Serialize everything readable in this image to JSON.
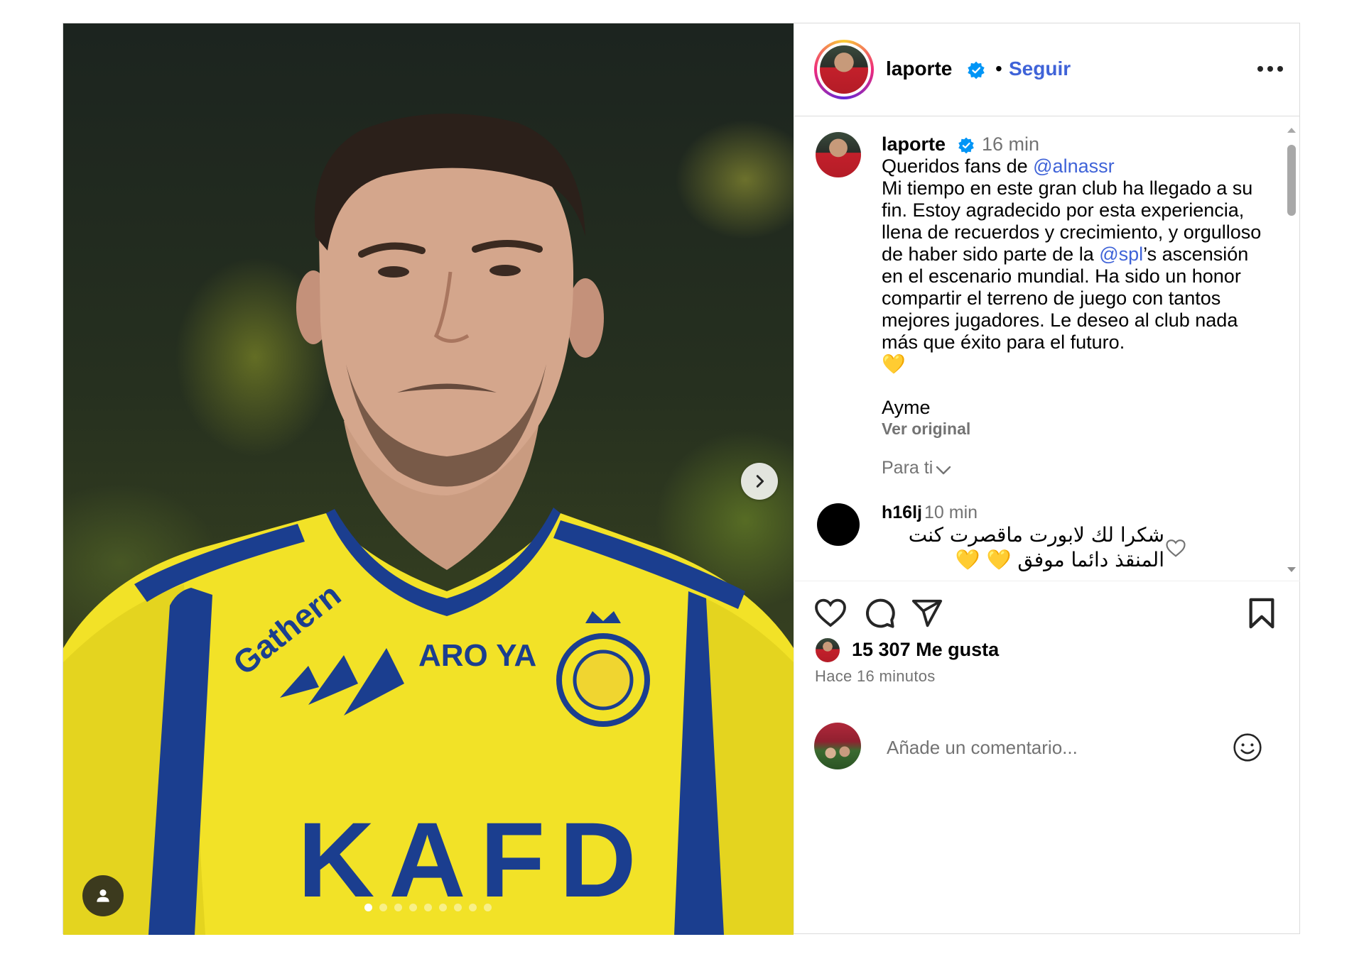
{
  "post": {
    "username": "laporte",
    "separator": "•",
    "follow_label": "Seguir",
    "more_icon": "more-options-icon",
    "carousel": {
      "total_slides": 9,
      "current_slide": 1
    }
  },
  "caption": {
    "username": "laporte",
    "time": "16 min",
    "greeting": "Queridos fans de ",
    "mention_club": "@alnassr",
    "line_a": "Mi tiempo en este gran club ha llegado a su fin. Estoy agradecido por esta experiencia, llena de recuerdos y crecimiento, y orgulloso de haber sido parte de la ",
    "mention_league": "@spl",
    "line_b": "’s ascensión en el escenario mundial. Ha sido un honor compartir el terreno de juego con tantos mejores jugadores. Le deseo al club nada más que éxito para el futuro.",
    "emoji": "💛",
    "signature": "Ayme",
    "see_original": "Ver original"
  },
  "for_you": {
    "label": "Para ti"
  },
  "comments": [
    {
      "username": "h16lj",
      "time": "10 min",
      "text": "شكرا لك لابورت ماقصرت كنت المنقذ دائما موفق 💛 💛"
    }
  ],
  "stats": {
    "likes": "15 307 Me gusta",
    "time_ago": "Hace 16 minutos"
  },
  "add_comment": {
    "placeholder": "Añade un comentario..."
  },
  "colors": {
    "link": "#3f63d8",
    "verified": "#0095f6",
    "muted": "#737373",
    "jersey_yellow": "#f2e227",
    "jersey_blue": "#1b3e8f"
  }
}
